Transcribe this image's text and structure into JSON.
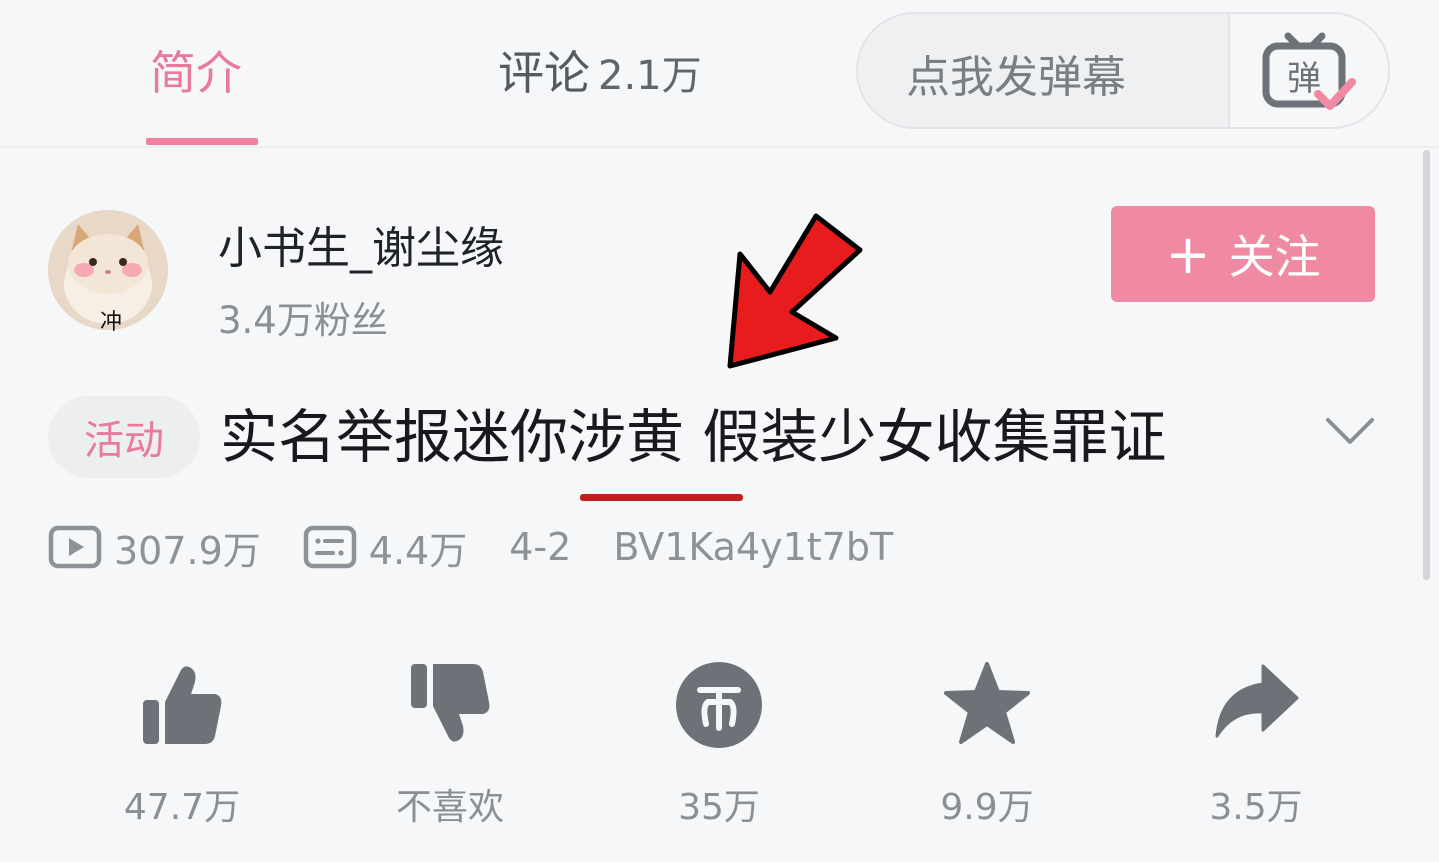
{
  "tabs": {
    "intro_label": "简介",
    "comments_label": "评论",
    "comments_count": "2.1万"
  },
  "danmaku": {
    "placeholder": "点我发弹幕",
    "toggle_icon": "danmaku-toggle-icon",
    "toggle_glyph": "弹"
  },
  "uploader": {
    "name": "小书生_谢尘缘",
    "fans": "3.4万粉丝",
    "avatar_caption": "冲",
    "follow_plus": "+",
    "follow_label": "关注"
  },
  "video": {
    "tag": "活动",
    "title": "实名举报迷你涉黄 假装少女收集罪证"
  },
  "stats": {
    "plays": "307.9万",
    "danmaku_count": "4.4万",
    "date": "4-2",
    "bvid": "BV1Ka4y1t7bT"
  },
  "actions": {
    "like": "47.7万",
    "dislike": "不喜欢",
    "coin": "35万",
    "favorite": "9.9万",
    "share": "3.5万"
  },
  "colors": {
    "accent_pink": "#f08aa3",
    "tab_pink": "#e87a9a",
    "icon_gray": "#6d7278",
    "annotation_red": "#e81c1c",
    "underline_red": "#c0201c"
  }
}
